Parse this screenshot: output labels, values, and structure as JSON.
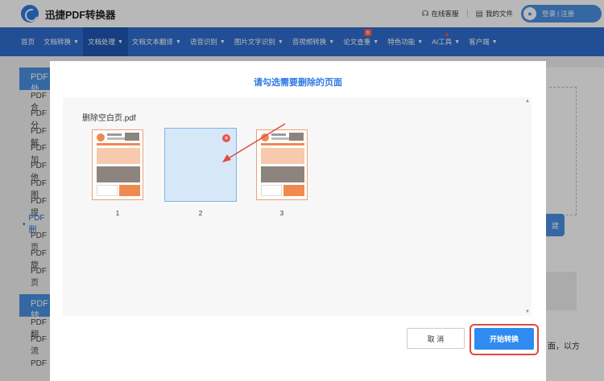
{
  "header": {
    "app_title": "迅捷PDF转换器",
    "service_label": "在线客服",
    "files_label": "我的文件",
    "login_label": "登录",
    "register_label": "注册"
  },
  "nav": {
    "items": [
      {
        "label": "首页"
      },
      {
        "label": "文档转换"
      },
      {
        "label": "文档处理"
      },
      {
        "label": "文档文本翻译"
      },
      {
        "label": "语音识别"
      },
      {
        "label": "图片文字识别"
      },
      {
        "label": "音视频转换"
      },
      {
        "label": "论文查重",
        "badge": "新"
      },
      {
        "label": "特色功能"
      },
      {
        "label": "AI工具"
      },
      {
        "label": "客户端"
      }
    ]
  },
  "sidebar": {
    "head1": "PDF处",
    "items": [
      "PDF合",
      "PDF分",
      "PDF解",
      "PDF加",
      "PDF他",
      "PDF图",
      "PDF提",
      "PDF删",
      "PDF页",
      "PDF旋",
      "PDF页"
    ],
    "head2": "PDF转",
    "items2": [
      "PDF翻",
      "PDF流",
      "PDF"
    ]
  },
  "background": {
    "right_text": "面，以方",
    "right_btn": "建"
  },
  "modal": {
    "title": "请勾选需要删除的页面",
    "file_name": "删除空白页.pdf",
    "pages": [
      "1",
      "2",
      "3"
    ],
    "cancel_label": "取 消",
    "start_label": "开始转换"
  },
  "colors": {
    "primary": "#2f6ccf",
    "accent_orange": "#f08a50",
    "highlight_red": "#e04b3f"
  }
}
